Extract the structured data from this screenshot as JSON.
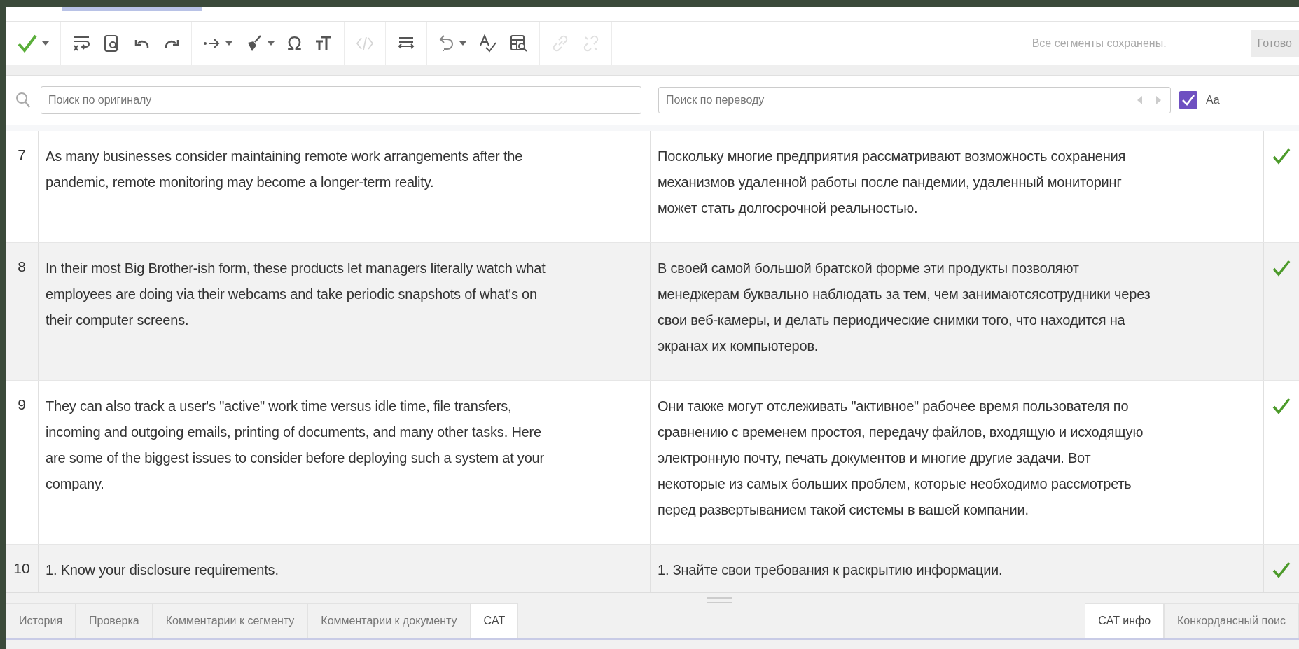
{
  "toolbar": {
    "groups": [
      [
        {
          "kind": "confirm",
          "dropdown": true,
          "disabled": false
        }
      ],
      [
        {
          "kind": "wrap",
          "dropdown": false,
          "disabled": false
        },
        {
          "kind": "find",
          "dropdown": false,
          "disabled": false
        },
        {
          "kind": "undo",
          "dropdown": false,
          "disabled": false
        },
        {
          "kind": "redo",
          "dropdown": false,
          "disabled": false
        }
      ],
      [
        {
          "kind": "arrow",
          "dropdown": true,
          "disabled": false
        },
        {
          "kind": "brush",
          "dropdown": true,
          "disabled": false
        },
        {
          "kind": "symbol",
          "label": "Ω",
          "dropdown": false,
          "disabled": false
        },
        {
          "kind": "textsize",
          "dropdown": false,
          "disabled": false
        }
      ],
      [
        {
          "kind": "tags",
          "dropdown": false,
          "disabled": true
        }
      ],
      [
        {
          "kind": "align",
          "dropdown": false,
          "disabled": false
        }
      ],
      [
        {
          "kind": "revert",
          "dropdown": true,
          "disabled": false
        },
        {
          "kind": "spell",
          "dropdown": false,
          "disabled": false
        },
        {
          "kind": "tablesearch",
          "dropdown": false,
          "disabled": false
        }
      ],
      [
        {
          "kind": "link",
          "dropdown": false,
          "disabled": true
        },
        {
          "kind": "unlink",
          "dropdown": false,
          "disabled": true
        }
      ]
    ],
    "status": "Все сегменты сохранены.",
    "done_button": {
      "label": "Готово",
      "disabled": true
    }
  },
  "search": {
    "source_placeholder": "Поиск по оригиналу",
    "target_placeholder": "Поиск по переводу",
    "nav_disabled": true,
    "match_case": {
      "label": "Aa",
      "checked": true
    }
  },
  "segments": [
    {
      "number": "7",
      "source": [
        "As many businesses consider maintaining remote work arrangements after the",
        "pandemic, remote monitoring may become a longer-term reality."
      ],
      "target": [
        "Поскольку многие предприятия рассматривают возможность сохранения",
        "механизмов удаленной работы после пандемии, удаленный мониторинг",
        "может стать долгосрочной реальностью."
      ],
      "confirmed": true
    },
    {
      "number": "8",
      "source": [
        "In their most Big Brother-ish form, these products let managers literally watch what",
        "employees are doing via their webcams and take periodic snapshots of what's on",
        "their computer screens."
      ],
      "target": [
        "В своей самой большой братской форме эти продукты позволяют",
        "менеджерам буквально наблюдать за тем, чем занимаютсясотрудники через",
        "свои веб-камеры, и делать периодические снимки того, что находится на",
        "экранах их компьютеров."
      ],
      "confirmed": true
    },
    {
      "number": "9",
      "source": [
        "They can also track a user's \"active\" work time versus idle time, file transfers,",
        "incoming and outgoing emails, printing of documents, and many other tasks. Here",
        "are some of the biggest issues to consider before deploying such a system at your",
        "company."
      ],
      "target": [
        "Они также могут отслеживать \"активное\" рабочее время пользователя по",
        "сравнению с временем простоя, передачу файлов, входящую и исходящую",
        "электронную почту, печать документов и многие другие задачи. Вот",
        "некоторые из самых больших проблем, которые необходимо рассмотреть",
        "перед развертыванием такой системы в вашей компании."
      ],
      "confirmed": true
    },
    {
      "number": "10",
      "source": [
        "1. Know your disclosure requirements."
      ],
      "target": [
        "1. Знайте свои требования к раскрытию информации."
      ],
      "confirmed": true
    }
  ],
  "bottom_tabs": [
    {
      "label": "История",
      "selected": false
    },
    {
      "label": "Проверка",
      "selected": false
    },
    {
      "label": "Комментарии к сегменту",
      "selected": false
    },
    {
      "label": "Комментарии к документу",
      "selected": false
    },
    {
      "label": "CAT",
      "selected": true
    }
  ],
  "side_tabs": [
    {
      "label": "CAT инфо",
      "selected": true
    },
    {
      "label": "Конкордансный поис",
      "selected": false
    }
  ]
}
